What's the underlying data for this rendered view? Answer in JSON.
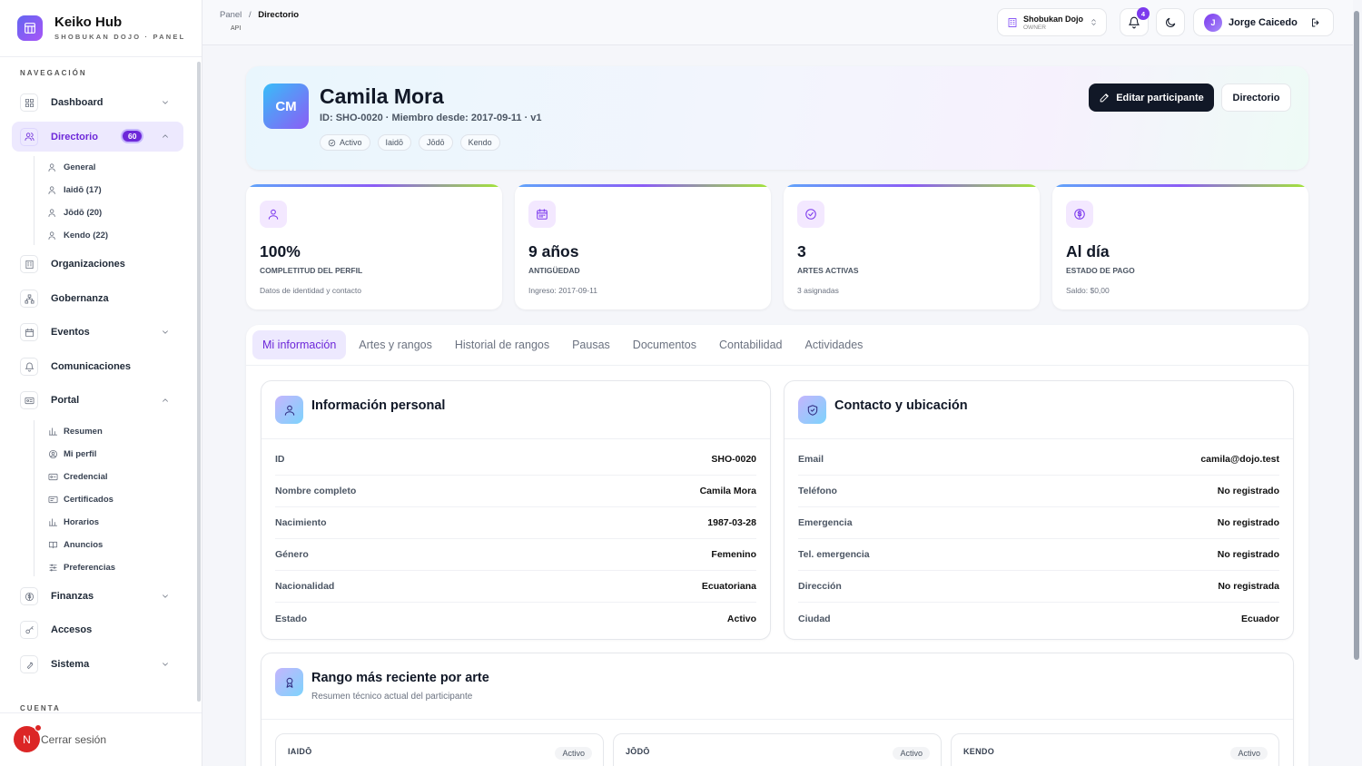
{
  "brand": {
    "name": "Keiko Hub",
    "subtitle": "SHOBUKAN DOJO · PANEL"
  },
  "sidebar": {
    "section_nav": "NAVEGACIÓN",
    "items": [
      {
        "label": "Dashboard",
        "icon": "grid-icon"
      },
      {
        "label": "Directorio",
        "icon": "users-icon",
        "badge": "60"
      },
      {
        "label": "Organizaciones",
        "icon": "building-icon"
      },
      {
        "label": "Gobernanza",
        "icon": "network-icon"
      },
      {
        "label": "Eventos",
        "icon": "calendar-icon"
      },
      {
        "label": "Comunicaciones",
        "icon": "bell-icon"
      },
      {
        "label": "Portal",
        "icon": "id-card-icon"
      },
      {
        "label": "Finanzas",
        "icon": "dollar-icon"
      },
      {
        "label": "Accesos",
        "icon": "key-icon"
      },
      {
        "label": "Sistema",
        "icon": "wrench-icon"
      }
    ],
    "directorio_sub": [
      "General",
      "Iaidō (17)",
      "Jōdō (20)",
      "Kendo (22)"
    ],
    "portal_sub": [
      "Resumen",
      "Mi perfil",
      "Credencial",
      "Certificados",
      "Horarios",
      "Anuncios",
      "Preferencias"
    ],
    "section_account": "CUENTA",
    "logout_label": "Cerrar sesión",
    "logout_avatar": "N"
  },
  "topbar": {
    "breadcrumb_root": "Panel",
    "breadcrumb_sep": "/",
    "breadcrumb_current": "Directorio",
    "api_tag": "API",
    "org_name": "Shobukan Dojo",
    "org_role": "OWNER",
    "notifications": "4",
    "user_initial": "J",
    "user_name": "Jorge Caicedo"
  },
  "profile": {
    "initials": "CM",
    "name": "Camila Mora",
    "meta": "ID: SHO-0020 · Miembro desde: 2017-09-11 · v1",
    "chips": [
      "Activo",
      "Iaidō",
      "Jōdō",
      "Kendo"
    ],
    "edit_button": "Editar participante",
    "directory_button": "Directorio"
  },
  "stats": [
    {
      "value": "100%",
      "label": "COMPLETITUD DEL PERFIL",
      "hint": "Datos de identidad y contacto",
      "icon": "user-icon"
    },
    {
      "value": "9 años",
      "label": "ANTIGÜEDAD",
      "hint": "Ingreso: 2017-09-11",
      "icon": "calendar-icon"
    },
    {
      "value": "3",
      "label": "ARTES ACTIVAS",
      "hint": "3 asignadas",
      "icon": "check-circle-icon"
    },
    {
      "value": "Al día",
      "label": "ESTADO DE PAGO",
      "hint": "Saldo: $0,00",
      "icon": "dollar-circle-icon"
    }
  ],
  "tabs": [
    "Mi información",
    "Artes y rangos",
    "Historial de rangos",
    "Pausas",
    "Documentos",
    "Contabilidad",
    "Actividades"
  ],
  "personal": {
    "title": "Información personal",
    "rows": [
      {
        "k": "ID",
        "v": "SHO-0020"
      },
      {
        "k": "Nombre completo",
        "v": "Camila Mora"
      },
      {
        "k": "Nacimiento",
        "v": "1987-03-28"
      },
      {
        "k": "Género",
        "v": "Femenino"
      },
      {
        "k": "Nacionalidad",
        "v": "Ecuatoriana"
      },
      {
        "k": "Estado",
        "v": "Activo"
      }
    ]
  },
  "contact": {
    "title": "Contacto y ubicación",
    "rows": [
      {
        "k": "Email",
        "v": "camila@dojo.test"
      },
      {
        "k": "Teléfono",
        "v": "No registrado"
      },
      {
        "k": "Emergencia",
        "v": "No registrado"
      },
      {
        "k": "Tel. emergencia",
        "v": "No registrado"
      },
      {
        "k": "Dirección",
        "v": "No registrada"
      },
      {
        "k": "Ciudad",
        "v": "Ecuador"
      }
    ]
  },
  "ranks": {
    "title": "Rango más reciente por arte",
    "subtitle": "Resumen técnico actual del participante",
    "items": [
      {
        "art": "IAIDŌ",
        "status": "Activo"
      },
      {
        "art": "JŌDŌ",
        "status": "Activo"
      },
      {
        "art": "KENDO",
        "status": "Activo"
      }
    ]
  }
}
